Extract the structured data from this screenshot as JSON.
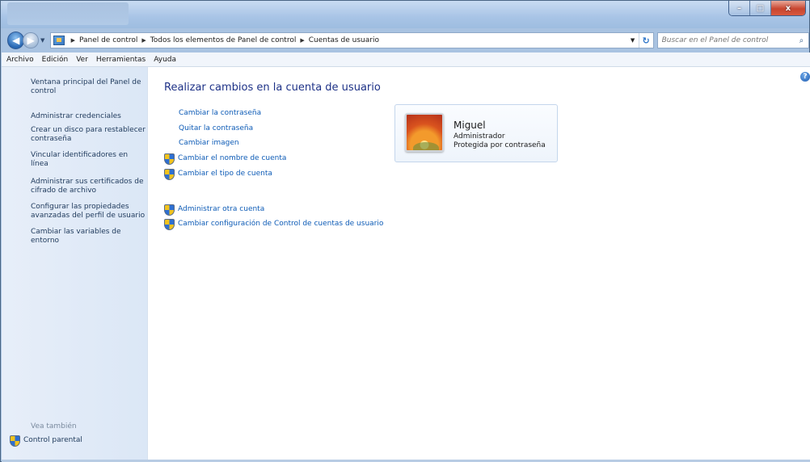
{
  "window": {
    "buttons": {
      "minimize": "–",
      "maximize": "□",
      "close": "x"
    }
  },
  "address": {
    "crumbs": [
      "Panel de control",
      "Todos los elementos de Panel de control",
      "Cuentas de usuario"
    ]
  },
  "search": {
    "placeholder": "Buscar en el Panel de control"
  },
  "menubar": [
    "Archivo",
    "Edición",
    "Ver",
    "Herramientas",
    "Ayuda"
  ],
  "sidebar": {
    "links": [
      "Ventana principal del Panel de control",
      "Administrar credenciales",
      "Crear un disco para restablecer contraseña",
      "Vincular identificadores en línea",
      "Administrar sus certificados de cifrado de archivo",
      "Configurar las propiedades avanzadas del perfil de usuario",
      "Cambiar las variables de entorno"
    ],
    "see_also": "Vea también",
    "parental": "Control parental"
  },
  "main": {
    "title": "Realizar cambios en la cuenta de usuario",
    "actions": [
      "Cambiar la contraseña",
      "Quitar la contraseña",
      "Cambiar imagen"
    ],
    "shield_actions": [
      "Cambiar el nombre de cuenta",
      "Cambiar el tipo de cuenta"
    ],
    "other_actions": [
      "Administrar otra cuenta",
      "Cambiar configuración de Control de cuentas de usuario"
    ]
  },
  "user": {
    "name": "Miguel",
    "role": "Administrador",
    "protection": "Protegida por contraseña"
  }
}
